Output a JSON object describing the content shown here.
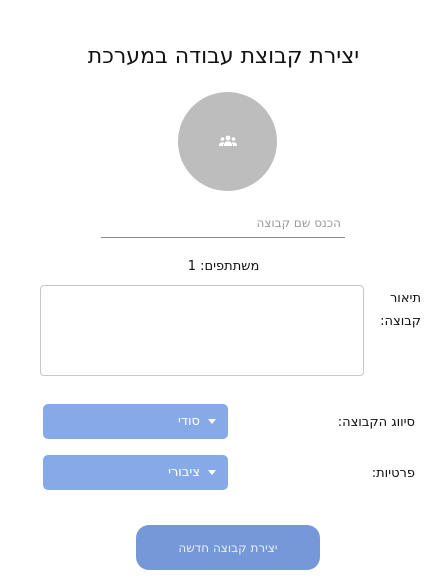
{
  "title": "יצירת קבוצת עבודה במערכת",
  "avatar": {
    "icon": "group-icon"
  },
  "group_name": {
    "value": "",
    "placeholder": "הכנס שם קבוצה"
  },
  "participants": {
    "text": "משתתפים: 1"
  },
  "description": {
    "label_line1": "תיאור",
    "label_line2": "קבוצה:",
    "value": ""
  },
  "classification": {
    "label": "סיווג הקבוצה:",
    "selected": "סודי"
  },
  "privacy": {
    "label": "פרטיות:",
    "selected": "ציבורי"
  },
  "create_button": {
    "label": "יצירת קבוצה חדשה"
  },
  "colors": {
    "dropdown": "#86a9e7",
    "button": "#7599d8",
    "avatar": "#bdbdbd"
  }
}
